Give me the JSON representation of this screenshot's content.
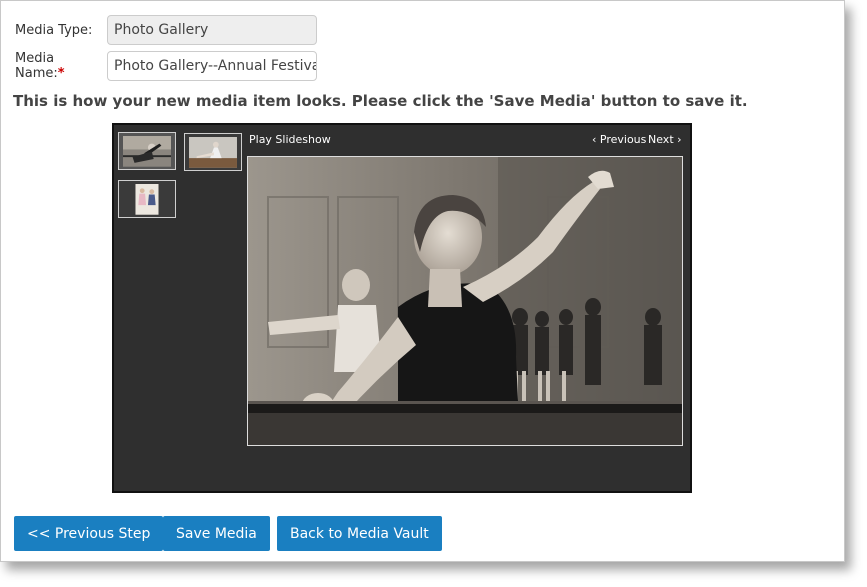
{
  "form": {
    "media_type": {
      "label": "Media Type:",
      "value": "Photo Gallery"
    },
    "media_name": {
      "label": "Media Name:",
      "required_mark": "*",
      "value": "Photo Gallery--Annual Festival"
    }
  },
  "instructions": "This is how your new media item looks. Please click the 'Save Media' button to save it.",
  "gallery": {
    "play_slideshow": "Play Slideshow",
    "previous": "‹ Previous",
    "next": "Next ›",
    "thumbnails": [
      {
        "name": "thumbnail-dancers-barre",
        "selected": true
      },
      {
        "name": "thumbnail-dancer-stretch",
        "selected": false
      },
      {
        "name": "thumbnail-young-dancers",
        "selected": false
      }
    ]
  },
  "buttons": {
    "previous_step": "<< Previous Step",
    "save_media": "Save Media",
    "back_to_vault": "Back to Media Vault"
  },
  "colors": {
    "button_bg": "#1a7fc1",
    "gallery_bg": "#2f2f2f",
    "required": "#cc0000"
  }
}
